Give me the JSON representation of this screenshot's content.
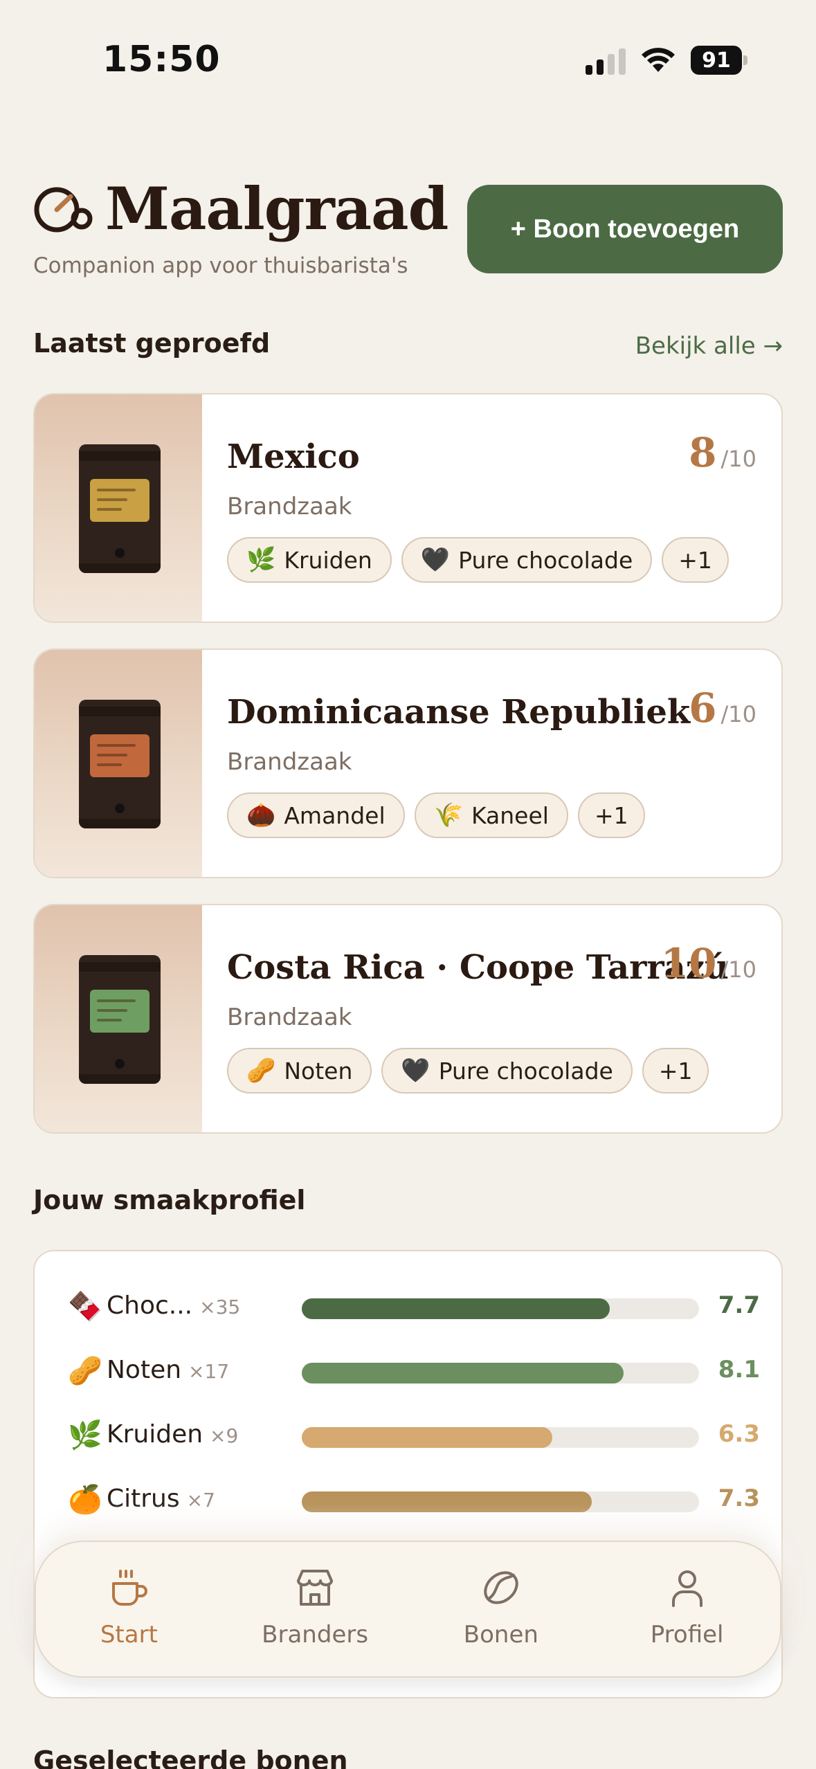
{
  "status_bar": {
    "time": "15:50",
    "battery": "91"
  },
  "header": {
    "title": "Maalgraad",
    "subtitle": "Companion app voor thuisbarista's",
    "add_button": "+ Boon toevoegen"
  },
  "recent": {
    "title": "Laatst geproefd",
    "see_all": "Bekijk alle →",
    "cards": [
      {
        "name": "Mexico",
        "roaster": "Brandzaak",
        "score": "8",
        "score_max": "/10",
        "label_color": "#c9a043",
        "tags": [
          {
            "emoji": "🌿",
            "label": "Kruiden"
          },
          {
            "emoji": "🖤",
            "label": "Pure chocolade"
          }
        ],
        "more": "+1"
      },
      {
        "name": "Dominicaanse Republiek",
        "roaster": "Brandzaak",
        "score": "6",
        "score_max": "/10",
        "label_color": "#c1683c",
        "tags": [
          {
            "emoji": "🌰",
            "label": "Amandel"
          },
          {
            "emoji": "🌾",
            "label": "Kaneel"
          }
        ],
        "more": "+1"
      },
      {
        "name": "Costa Rica · Coope Tarrazú",
        "roaster": "Brandzaak",
        "score": "10",
        "score_max": "/10",
        "label_color": "#6f9e62",
        "tags": [
          {
            "emoji": "🥜",
            "label": "Noten"
          },
          {
            "emoji": "🖤",
            "label": "Pure chocolade"
          }
        ],
        "more": "+1"
      }
    ]
  },
  "taste_profile": {
    "title": "Jouw smaakprofiel",
    "rows": [
      {
        "emoji": "🍫",
        "label": "Choc...",
        "count": "×35",
        "score": "7.7",
        "level": 0.775,
        "bar_color": "#4c6b45",
        "score_color": "#4c6b45"
      },
      {
        "emoji": "🥜",
        "label": "Noten",
        "count": "×17",
        "score": "8.1",
        "level": 0.81,
        "bar_color": "#6b8f5f",
        "score_color": "#6b8f5f"
      },
      {
        "emoji": "🌿",
        "label": "Kruiden",
        "count": "×9",
        "score": "6.3",
        "level": 0.63,
        "bar_color": "#d5a96f",
        "score_color": "#d5a96f"
      },
      {
        "emoji": "🍊",
        "label": "Citrus",
        "count": "×7",
        "score": "7.3",
        "level": 0.73,
        "bar_color": "#b8925a",
        "score_color": "#b8925a"
      }
    ]
  },
  "selected": {
    "title": "Geselecteerde bonen"
  },
  "tabbar": {
    "tabs": [
      {
        "label": "Start",
        "icon": "coffee-cup-icon",
        "active": true
      },
      {
        "label": "Branders",
        "icon": "store-icon",
        "active": false
      },
      {
        "label": "Bonen",
        "icon": "coffee-bean-icon",
        "active": false
      },
      {
        "label": "Profiel",
        "icon": "user-icon",
        "active": false
      }
    ]
  },
  "colors": {
    "accent": "#4c6b45",
    "score": "#b57845",
    "background": "#f4f0ea"
  }
}
